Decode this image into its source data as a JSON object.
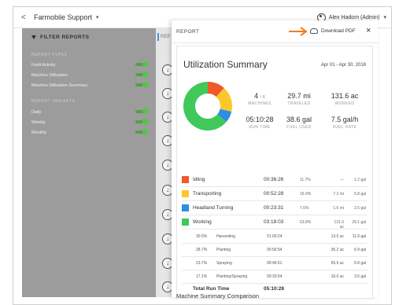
{
  "topbar": {
    "back_glyph": "<",
    "app_title": "Farmobile Support",
    "caret": "▾",
    "user": "Alex Hadom (Admin)",
    "user_caret": "▾"
  },
  "sidebar": {
    "title": "FILTER REPORTS",
    "types_label": "REPORT TYPES",
    "types": [
      "Field Activity",
      "Machine Utilization",
      "Machine Utilization Summary"
    ],
    "variants_label": "REPORT VARIANTS",
    "variants": [
      "Daily",
      "Weekly",
      "Monthly"
    ]
  },
  "main": {
    "tab_label": "REP",
    "download_glyph": "↓"
  },
  "panel": {
    "title": "REPORT",
    "download_pdf": "Download PDF",
    "close": "×",
    "summary_title": "Utilization Summary",
    "date_range": "Apr 01 - Apr 30, 2018",
    "stats": {
      "machines_value": "4",
      "machines_total": "/ 6",
      "machines_label": "MACHINES",
      "traveled_value": "29.7 mi",
      "traveled_label": "TRAVELED",
      "worked_value": "131.6 ac",
      "worked_label": "WORKED",
      "runtime_value": "05:10:28",
      "runtime_label": "RUN TIME",
      "fuel_used_value": "38.6 gal",
      "fuel_used_label": "FUEL USED",
      "fuel_rate_value": "7.5 gal/h",
      "fuel_rate_label": "FUEL RATE"
    },
    "donut": [
      {
        "name": "Idling",
        "percent": 11.7,
        "color": "#f0592a"
      },
      {
        "name": "Transporting",
        "percent": 16.9,
        "color": "#fcc72b"
      },
      {
        "name": "Headland Turning",
        "percent": 7.6,
        "color": "#2f8de4"
      },
      {
        "name": "Working",
        "percent": 63.8,
        "color": "#3ec95a"
      }
    ],
    "activities": [
      {
        "name": "Idling",
        "time": "00:36:26",
        "percent": "11.7%",
        "distance": "---",
        "fuel": "1.2 gal",
        "color": "#f0592a"
      },
      {
        "name": "Transporting",
        "time": "00:52:28",
        "percent": "16.9%",
        "distance": "7.2 mi",
        "fuel": "5.8 gal",
        "color": "#fcc72b"
      },
      {
        "name": "Headland Turning",
        "time": "00:23:31",
        "percent": "7.6%",
        "distance": "1.6 mi",
        "fuel": "2.5 gal",
        "color": "#2f8de4"
      },
      {
        "name": "Working",
        "time": "03:18:03",
        "percent": "63.8%",
        "distance": "131.6 ac",
        "fuel": "29.1 gal",
        "color": "#3ec95a"
      }
    ],
    "working_breakdown": [
      {
        "percent": "30.5%",
        "name": "Harvesting",
        "time": "01:00:24",
        "area": "13.5 ac",
        "fuel": "11.9 gal"
      },
      {
        "percent": "28.7%",
        "name": "Planting",
        "time": "00:56:54",
        "area": "36.2 ac",
        "fuel": "6.9 gal"
      },
      {
        "percent": "23.7%",
        "name": "Spraying",
        "time": "00:46:51",
        "area": "65.9 ac",
        "fuel": "6.8 gal"
      },
      {
        "percent": "17.1%",
        "name": "Planting/Spraying",
        "time": "00:33:54",
        "area": "16.0 ac",
        "fuel": "3.6 gal"
      }
    ],
    "total_label": "Total Run Time",
    "total_value": "05:10:28",
    "next_section": "Machine Summary Comparison"
  },
  "colors": {
    "accent_orange": "#ef7d22",
    "toggle_on": "#4cc93f",
    "sidebar_bg": "#9c9c9c"
  }
}
